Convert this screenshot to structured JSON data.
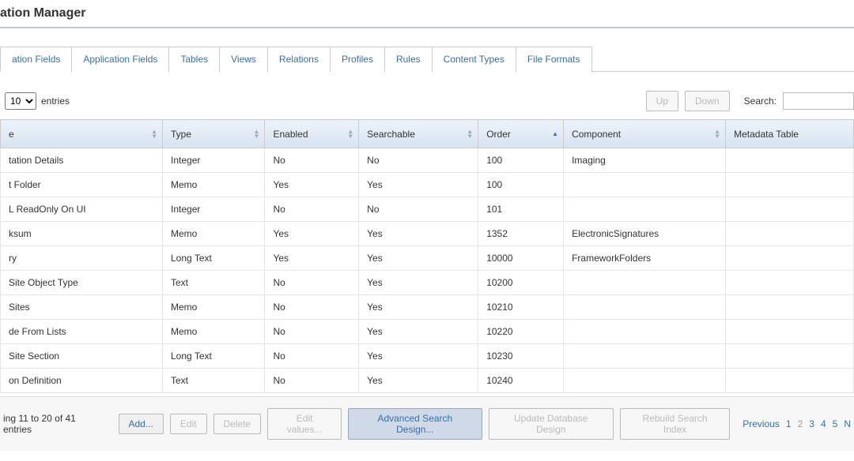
{
  "title": "ation Manager",
  "tabs": [
    {
      "label": "ation Fields",
      "active": true
    },
    {
      "label": "Application Fields"
    },
    {
      "label": "Tables"
    },
    {
      "label": "Views"
    },
    {
      "label": "Relations"
    },
    {
      "label": "Profiles"
    },
    {
      "label": "Rules"
    },
    {
      "label": "Content Types"
    },
    {
      "label": "File Formats"
    }
  ],
  "toolbar": {
    "entries_prefix": "",
    "entries_select": "10",
    "entries_suffix": "entries",
    "up": "Up",
    "down": "Down",
    "search_label": "Search:",
    "search_value": ""
  },
  "columns": [
    {
      "label": "e",
      "sort": "both",
      "width": "19%"
    },
    {
      "label": "Type",
      "sort": "both",
      "width": "12%"
    },
    {
      "label": "Enabled",
      "sort": "both",
      "width": "11%"
    },
    {
      "label": "Searchable",
      "sort": "both",
      "width": "14%"
    },
    {
      "label": "Order",
      "sort": "asc",
      "width": "10%"
    },
    {
      "label": "Component",
      "sort": "both",
      "width": "19%"
    },
    {
      "label": "Metadata Table",
      "sort": "none",
      "width": "15%"
    }
  ],
  "rows": [
    {
      "name": "tation Details",
      "type": "Integer",
      "enabled": "No",
      "searchable": "No",
      "order": "100",
      "component": "Imaging",
      "meta": ""
    },
    {
      "name": "t Folder",
      "type": "Memo",
      "enabled": "Yes",
      "searchable": "Yes",
      "order": "100",
      "component": "",
      "meta": ""
    },
    {
      "name": "L ReadOnly On UI",
      "type": "Integer",
      "enabled": "No",
      "searchable": "No",
      "order": "101",
      "component": "",
      "meta": ""
    },
    {
      "name": "ksum",
      "type": "Memo",
      "enabled": "Yes",
      "searchable": "Yes",
      "order": "1352",
      "component": "ElectronicSignatures",
      "meta": ""
    },
    {
      "name": "ry",
      "type": "Long Text",
      "enabled": "Yes",
      "searchable": "Yes",
      "order": "10000",
      "component": "FrameworkFolders",
      "meta": ""
    },
    {
      "name": "Site Object Type",
      "type": "Text",
      "enabled": "No",
      "searchable": "Yes",
      "order": "10200",
      "component": "",
      "meta": ""
    },
    {
      "name": "Sites",
      "type": "Memo",
      "enabled": "No",
      "searchable": "Yes",
      "order": "10210",
      "component": "",
      "meta": ""
    },
    {
      "name": "de From Lists",
      "type": "Memo",
      "enabled": "No",
      "searchable": "Yes",
      "order": "10220",
      "component": "",
      "meta": ""
    },
    {
      "name": "Site Section",
      "type": "Long Text",
      "enabled": "No",
      "searchable": "Yes",
      "order": "10230",
      "component": "",
      "meta": ""
    },
    {
      "name": "on Definition",
      "type": "Text",
      "enabled": "No",
      "searchable": "Yes",
      "order": "10240",
      "component": "",
      "meta": ""
    }
  ],
  "footer": {
    "info": "ing 11 to 20 of 41 entries",
    "add": "Add...",
    "edit": "Edit",
    "delete": "Delete",
    "edit_values": "Edit values...",
    "adv_search": "Advanced Search Design...",
    "update_db": "Update Database Design",
    "rebuild": "Rebuild Search Index",
    "prev": "Previous",
    "pages": [
      "1",
      "2",
      "3",
      "4",
      "5"
    ],
    "current_page": "2",
    "next": "N"
  }
}
